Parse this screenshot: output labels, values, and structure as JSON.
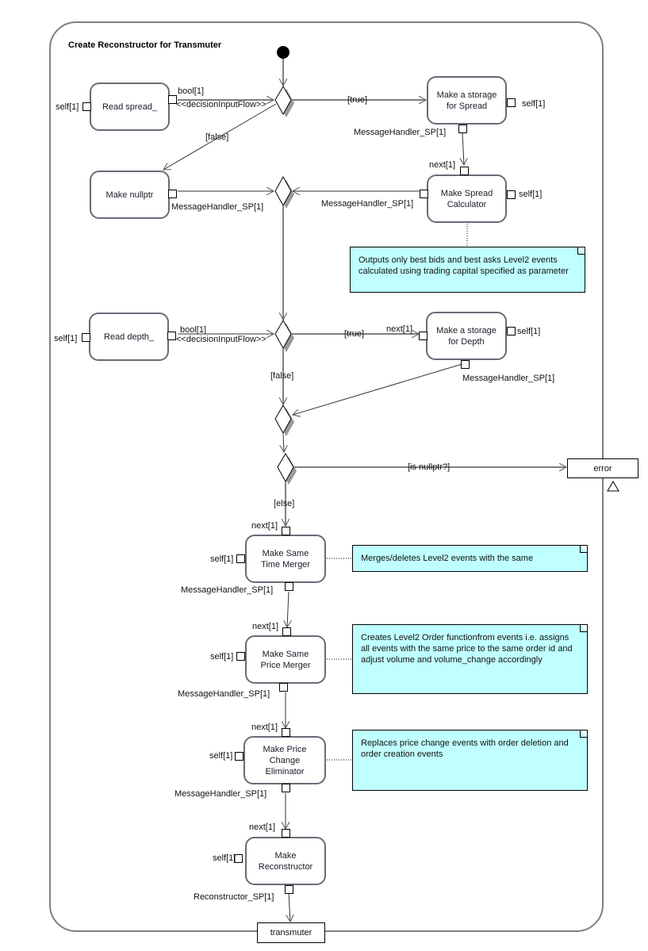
{
  "diagram": {
    "title": "Create Reconstructor for Transmuter",
    "actions": {
      "read_spread": "Read spread_",
      "make_nullptr": "Make nullptr",
      "storage_spread": "Make a storage for Spread",
      "spread_calculator": "Make Spread Calculator",
      "read_depth": "Read depth_",
      "storage_depth": "Make a storage for Depth",
      "same_time_merger": "Make Same Time Merger",
      "same_price_merger": "Make Same Price Merger",
      "price_change_eliminator": "Make Price Change Eliminator",
      "reconstructor": "Make Reconstructor"
    },
    "pins": {
      "error": "error",
      "transmuter": "transmuter"
    },
    "port_labels": {
      "self": "self[1]",
      "bool": "bool[1]",
      "next": "next[1]",
      "message_handler": "MessageHandler_SP[1]",
      "reconstructor_sp": "Reconstructor_SP[1]",
      "decision_input": "<<decisionInputFlow>>"
    },
    "guards": {
      "true": "[true]",
      "false": "[false]",
      "is_nullptr": "[is nullptr?]",
      "else": "[else]"
    },
    "notes": {
      "spread_calculator": "Outputs only best bids and best asks Level2 events calculated using trading capital specified as parameter",
      "same_time_merger": "Merges/deletes Level2 events with the same",
      "same_price_merger": "Creates Level2 Order functionfrom events i.e. assigns all events with the same price to the same order id and adjust volume and volume_change accordingly",
      "price_change_eliminator": "Replaces price change events with order deletion and order creation events"
    },
    "colors": {
      "note_fill": "#c0ffff",
      "frame_stroke": "#808080",
      "action_stroke": "#6a6a78"
    }
  }
}
